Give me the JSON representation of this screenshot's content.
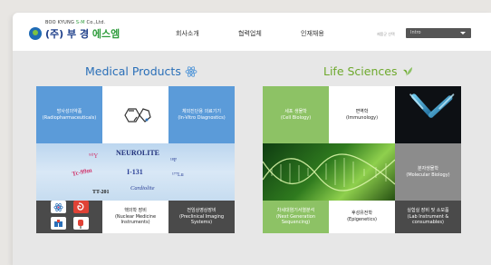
{
  "header": {
    "company_en_prefix": "BOO KYUNG ",
    "company_en_highlight": "S-M",
    "company_en_suffix": " Co.,Ltd.",
    "company_ko_prefix": "(주) 부 경 ",
    "company_ko_highlight": "에스엠",
    "nav": [
      "회사소개",
      "협력업체",
      "인재채용"
    ],
    "lang_label": "제품군 선택",
    "lang_value": "Intro"
  },
  "medical": {
    "title": "Medical Products",
    "tiles": {
      "radiopharma": {
        "ko": "방사성의약품",
        "en": "(Radiopharmaceuticals)"
      },
      "ivd": {
        "ko": "체외진단용 의료기기",
        "en": "(In-Vitro Diagnostics)"
      },
      "nuclear": {
        "ko": "핵의학 장비",
        "en": "(Nuclear Medicine Instruments)"
      },
      "preclinical": {
        "ko": "전임상영상장비",
        "en": "(Preclinical Imaging Systems)"
      }
    },
    "banner_words": [
      "NEUROLITE",
      "I-131",
      "Tc-99m",
      "Cardiolite",
      "TT-201",
      "¹⁷⁷Lu",
      "¹⁸F",
      "⁹⁰Y"
    ]
  },
  "life": {
    "title": "Life Sciences",
    "tiles": {
      "cell": {
        "ko": "세포 생물학",
        "en": "(Cell Biology)"
      },
      "immunology": {
        "ko": "면역학",
        "en": "(Immunology)"
      },
      "molecular": {
        "ko": "분자생물학",
        "en": "(Molecular Biology)"
      },
      "ngs": {
        "ko": "차세대염기서열분석",
        "en": "(Next Generation Sequencing)"
      },
      "epigenetics": {
        "ko": "후성유전학",
        "en": "(Epigenetics)"
      },
      "lab": {
        "ko": "실험실 장비 및 소모품",
        "en": "(Lab Instrument & consumables)"
      }
    }
  },
  "colors": {
    "medical_blue": "#5b9bd9",
    "life_green": "#8dc265",
    "dark_gray": "#4a4a4a",
    "mid_gray": "#8c8c8c"
  }
}
